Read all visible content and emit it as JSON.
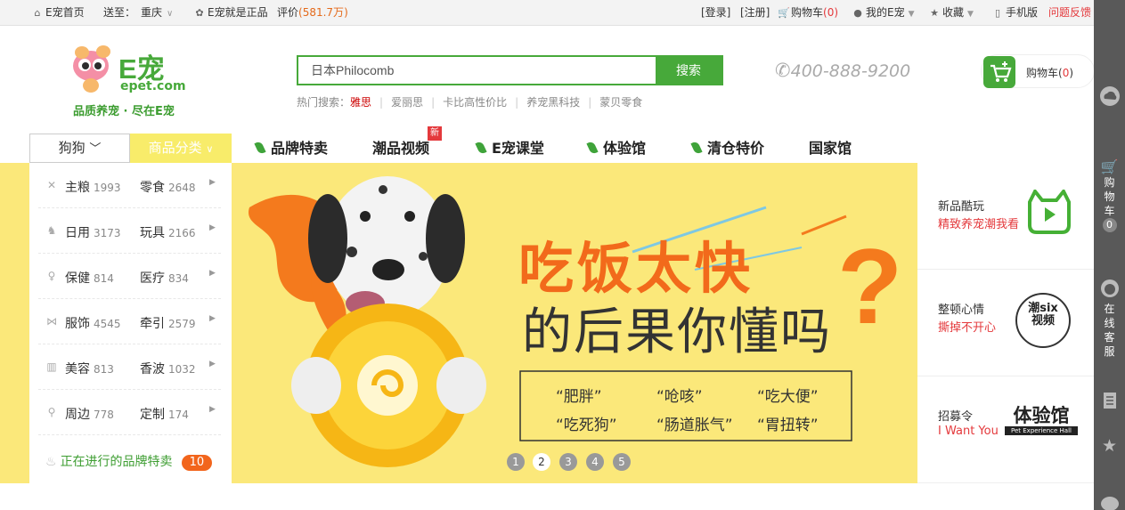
{
  "topbar": {
    "home": "E宠首页",
    "deliver_label": "送至：",
    "deliver_city": "重庆",
    "genuine": "E宠就是正品",
    "rating_label": "评价",
    "rating_value": "581.7万",
    "login": "[登录]",
    "register": "[注册]",
    "cart": "购物车",
    "cart_count": "(0)",
    "my": "我的E宠",
    "favorite": "收藏",
    "mobile": "手机版",
    "feedback": "问题反馈"
  },
  "logo": {
    "brand": "E宠",
    "domain": "epet.com",
    "slogan": "品质养宠 · 尽在E宠"
  },
  "search": {
    "value": "日本Philocomb",
    "button": "搜索",
    "hot_label": "热门搜索：",
    "hot": [
      "雅思",
      "爱丽思",
      "卡比高性价比",
      "养宠黑科技",
      "蒙贝零食"
    ]
  },
  "phone": "400-888-9200",
  "cart_button": {
    "label": "购物车(",
    "count": "0",
    "close": ")"
  },
  "nav": {
    "pet_type": "狗狗",
    "category": "商品分类",
    "items": [
      "品牌特卖",
      "潮品视频",
      "E宠课堂",
      "体验馆",
      "清仓特价",
      "国家馆"
    ],
    "new_tag": "新"
  },
  "categories": [
    {
      "a": "主粮",
      "an": "1993",
      "b": "零食",
      "bn": "2648",
      "icon": "bone-icon"
    },
    {
      "a": "日用",
      "an": "3173",
      "b": "玩具",
      "bn": "2166",
      "icon": "dog-icon"
    },
    {
      "a": "保健",
      "an": "814",
      "b": "医疗",
      "bn": "834",
      "icon": "health-icon"
    },
    {
      "a": "服饰",
      "an": "4545",
      "b": "牵引",
      "bn": "2579",
      "icon": "bowtie-icon"
    },
    {
      "a": "美容",
      "an": "813",
      "b": "香波",
      "bn": "1032",
      "icon": "brush-icon"
    },
    {
      "a": "周边",
      "an": "778",
      "b": "定制",
      "bn": "174",
      "icon": "location-icon"
    }
  ],
  "brand_sale": {
    "label": "正在进行的品牌特卖",
    "count": "10"
  },
  "banner": {
    "headline1": "吃饭太快",
    "headline2": "的后果你懂吗",
    "bullets": [
      "“肥胖”",
      "“呛咳”",
      "“吃大便”",
      "“吃死狗”",
      "“肠道胀气”",
      "“胃扭转”"
    ],
    "dots": [
      "1",
      "2",
      "3",
      "4",
      "5"
    ],
    "active_dot": 2
  },
  "promos": [
    {
      "title": "新品酷玩",
      "sub": "精致养宠潮我看",
      "icon": "tv-cat-icon"
    },
    {
      "title": "整顿心情",
      "sub": "撕掉不开心",
      "icon": "six-video-icon",
      "badge": "潮six视频"
    },
    {
      "title": "招募令",
      "sub": "I Want You",
      "icon": "experience-hall-icon",
      "badge": "体验馆",
      "badge_sub": "Pet Experience Hall"
    }
  ],
  "toolbar": {
    "cart_text": [
      "购",
      "物",
      "车"
    ],
    "cart_count": "0",
    "service_text": [
      "在",
      "线",
      "客",
      "服"
    ]
  },
  "colors": {
    "green": "#47a93a",
    "yellow": "#fbe87a",
    "orange": "#f2651c",
    "red": "#e4393c"
  }
}
